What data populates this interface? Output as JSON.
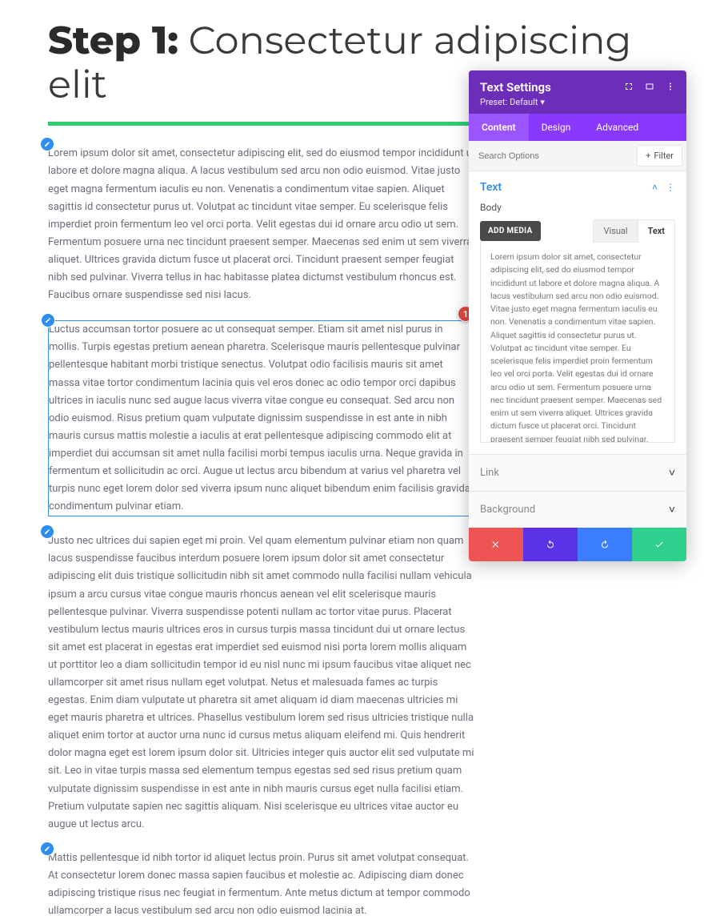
{
  "heading": {
    "bold": "Step 1:",
    "rest": " Consectetur adipiscing elit"
  },
  "paragraphs": [
    "Lorem ipsum dolor sit amet, consectetur adipiscing elit, sed do eiusmod tempor incididunt ut labore et dolore magna aliqua. A lacus vestibulum sed arcu non odio euismod. Vitae justo eget magna fermentum iaculis eu non. Venenatis a condimentum vitae sapien. Aliquet sagittis id consectetur purus ut. Volutpat ac tincidunt vitae semper. Eu scelerisque felis imperdiet proin fermentum leo vel orci porta. Velit egestas dui id ornare arcu odio ut sem. Fermentum posuere urna nec tincidunt praesent semper. Maecenas sed enim ut sem viverra aliquet. Ultrices gravida dictum fusce ut placerat orci. Tincidunt praesent semper feugiat nibh sed pulvinar. Viverra tellus in hac habitasse platea dictumst vestibulum rhoncus est. Faucibus ornare suspendisse sed nisi lacus.",
    "Luctus accumsan tortor posuere ac ut consequat semper. Etiam sit amet nisl purus in mollis. Turpis egestas pretium aenean pharetra. Scelerisque mauris pellentesque pulvinar pellentesque habitant morbi tristique senectus. Volutpat odio facilisis mauris sit amet massa vitae tortor condimentum lacinia quis vel eros donec ac odio tempor orci dapibus ultrices in iaculis nunc sed augue lacus viverra vitae congue eu consequat. Sed arcu non odio euismod. Risus pretium quam vulputate dignissim suspendisse in est ante in nibh mauris cursus mattis molestie a iaculis at erat pellentesque adipiscing commodo elit at imperdiet dui accumsan sit amet nulla facilisi morbi tempus iaculis urna. Neque gravida in fermentum et sollicitudin ac orci. Augue ut lectus arcu bibendum at varius vel pharetra vel turpis nunc eget lorem dolor sed viverra ipsum nunc aliquet bibendum enim facilisis gravida condimentum pulvinar etiam.",
    "Justo nec ultrices dui sapien eget mi proin. Vel quam elementum pulvinar etiam non quam lacus suspendisse faucibus interdum posuere lorem ipsum dolor sit amet consectetur adipiscing elit duis tristique sollicitudin nibh sit amet commodo nulla facilisi nullam vehicula ipsum a arcu cursus vitae congue mauris rhoncus aenean vel elit scelerisque mauris pellentesque pulvinar. Viverra suspendisse potenti nullam ac tortor vitae purus. Placerat vestibulum lectus mauris ultrices eros in cursus turpis massa tincidunt dui ut ornare lectus sit amet est placerat in egestas erat imperdiet sed euismod nisi porta lorem mollis aliquam ut porttitor leo a diam sollicitudin tempor id eu nisl nunc mi ipsum faucibus vitae aliquet nec ullamcorper sit amet risus nullam eget volutpat. Netus et malesuada fames ac turpis egestas. Enim diam vulputate ut pharetra sit amet aliquam id diam maecenas ultricies mi eget mauris pharetra et ultrices. Phasellus vestibulum lorem sed risus ultricies tristique nulla aliquet enim tortor at auctor urna nunc id cursus metus aliquam eleifend mi. Quis hendrerit dolor magna eget est lorem ipsum dolor sit. Ultricies integer quis auctor elit sed vulputate mi sit. Leo in vitae turpis massa sed elementum tempus egestas sed sed risus pretium quam vulputate dignissim suspendisse in est ante in nibh mauris cursus eget nulla facilisi etiam. Pretium vulputate sapien nec sagittis aliquam. Nisi scelerisque eu ultrices vitae auctor eu augue ut lectus arcu.",
    "Mattis pellentesque id nibh tortor id aliquet lectus proin. Purus sit amet volutpat consequat. At consectetur lorem donec massa sapien faucibus et molestie ac. Adipiscing diam donec adipiscing tristique risus nec feugiat in fermentum. Ante metus dictum at tempor commodo ullamcorper a lacus vestibulum sed arcu non odio euismod lacinia at."
  ],
  "panel": {
    "title": "Text Settings",
    "preset_label": "Preset:",
    "preset_value": "Default",
    "tabs": {
      "content": "Content",
      "design": "Design",
      "advanced": "Advanced"
    },
    "search_placeholder": "Search Options",
    "filter_label": "Filter",
    "section_text": "Text",
    "body_label": "Body",
    "add_media": "ADD MEDIA",
    "mode_visual": "Visual",
    "mode_text": "Text",
    "editor_body": "Lorem ipsum dolor sit amet, consectetur adipiscing elit, sed do eiusmod tempor incididunt ut labore et dolore magna aliqua. A lacus vestibulum sed arcu non odio euismod. Vitae justo eget magna fermentum iaculis eu non. Venenatis a condimentum vitae sapien. Aliquet sagittis id consectetur purus ut. Volutpat ac tincidunt vitae semper. Eu scelerisque felis imperdiet proin fermentum leo vel orci porta. Velit egestas dui id ornare arcu odio ut sem. Fermentum posuere urna nec tincidunt praesent semper. Maecenas sed enim ut sem viverra aliquet. Ultrices gravida dictum fusce ut placerat orci. Tincidunt praesent semper feugiat nibh sed pulvinar. Viverra tellus in hac habitasse platea dictumst vestibulum rhoncus est. Faucibus ornare suspendisse sed nisi lacus.",
    "acc_link": "Link",
    "acc_bg": "Background"
  },
  "marker": "1"
}
